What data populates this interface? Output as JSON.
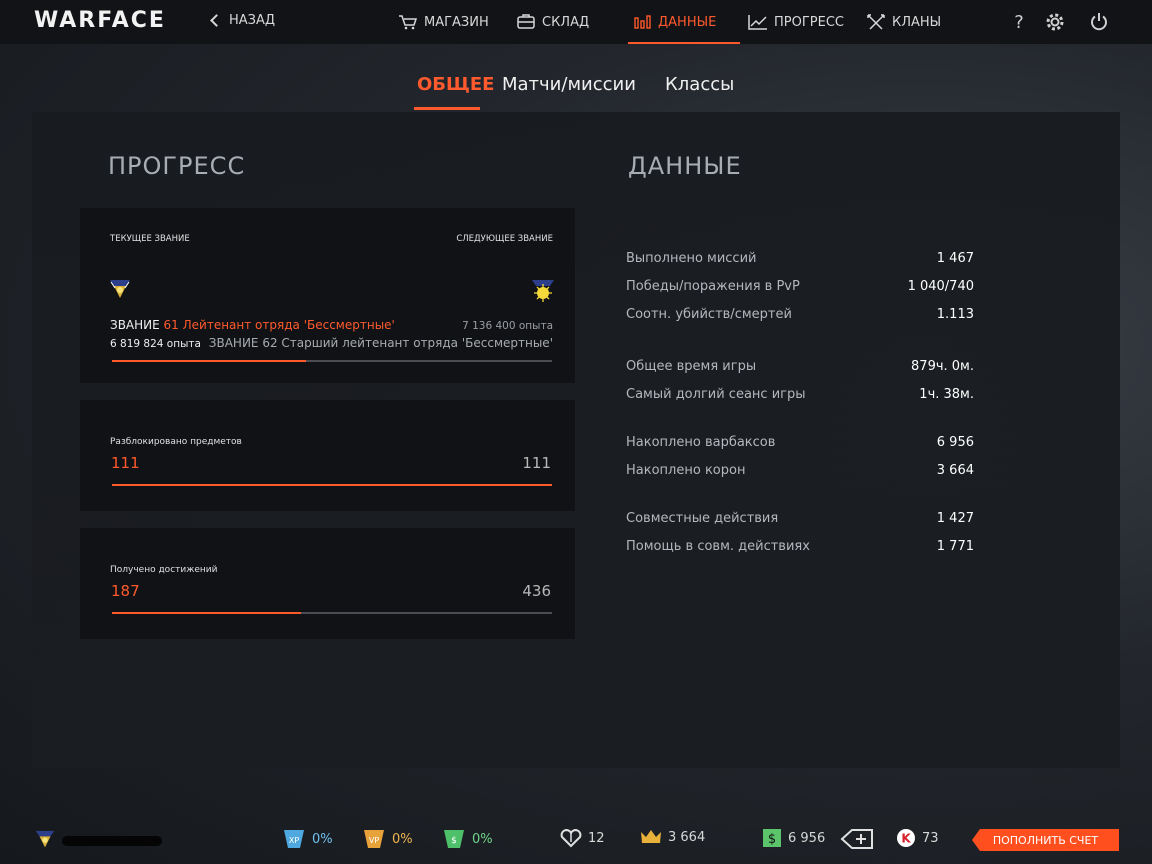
{
  "app": {
    "logo": "WARFACE",
    "back_label": "НАЗАД"
  },
  "nav": [
    {
      "label": "МАГАЗИН",
      "icon": "cart-icon",
      "active": false
    },
    {
      "label": "СКЛАД",
      "icon": "inventory-icon",
      "active": false
    },
    {
      "label": "ДАННЫЕ",
      "icon": "bar-chart-icon",
      "active": true
    },
    {
      "label": "ПРОГРЕСС",
      "icon": "progress-chart-icon",
      "active": false
    },
    {
      "label": "КЛАНЫ",
      "icon": "crossed-swords-icon",
      "active": false
    }
  ],
  "top_icons": {
    "help": "?",
    "settings": "gear-icon",
    "power": "power-icon"
  },
  "tabs": [
    {
      "label": "ОБЩЕЕ",
      "active": true
    },
    {
      "label": "Матчи/миссии",
      "active": false
    },
    {
      "label": "Классы",
      "active": false
    }
  ],
  "progress": {
    "title": "ПРОГРЕСС",
    "rank": {
      "current_label": "ТЕКУЩЕЕ ЗВАНИЕ",
      "next_label": "СЛЕДУЮЩЕЕ ЗВАНИЕ",
      "current_prefix": "ЗВАНИЕ",
      "current_name": "61 Лейтенант отряда 'Бессмертные'",
      "current_xp": "6 819 824 опыта",
      "next_xp": "7 136 400 опыта",
      "next_name": "ЗВАНИЕ 62 Старший лейтенант отряда 'Бессмертные'",
      "fill": 0.44
    },
    "unlocked": {
      "label": "Разблокировано предметов",
      "value": "111",
      "total": "111",
      "fill": 1.0
    },
    "achievements": {
      "label": "Получено достижений",
      "value": "187",
      "total": "436",
      "fill": 0.43
    }
  },
  "data": {
    "title": "ДАННЫЕ",
    "rows": [
      {
        "label": "Выполнено миссий",
        "value": "1 467"
      },
      {
        "label": "Победы/поражения в PvP",
        "value": "1 040/740"
      },
      {
        "label": "Соотн. убийств/смертей",
        "value": "1.113"
      },
      {
        "label": "Общее время игры",
        "value": "879ч. 0м."
      },
      {
        "label": "Самый долгий сеанс игры",
        "value": "1ч. 38м."
      },
      {
        "label": "Накоплено варбаксов",
        "value": "6 956"
      },
      {
        "label": "Накоплено корон",
        "value": "3 664"
      },
      {
        "label": "Совместные действия",
        "value": "1 427"
      },
      {
        "label": "Помощь в совм. действиях",
        "value": "1 771"
      }
    ]
  },
  "bottom": {
    "boost_xp": "0%",
    "boost_vp": "0%",
    "boost_money": "0%",
    "tokens": "12",
    "crowns": "3 664",
    "warbucks": "6 956",
    "kredits": "73",
    "topup_label": "ПОПОЛНИТЬ СЧЕТ"
  },
  "colors": {
    "accent": "#ff5a2e",
    "panel": "#101215",
    "topbar": "#111316"
  }
}
